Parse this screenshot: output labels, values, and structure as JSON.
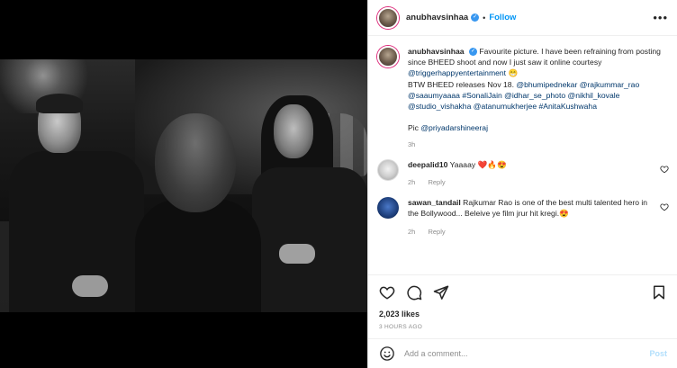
{
  "post": {
    "username": "anubhavsinhaa",
    "verified_glyph": "✓",
    "dot": "•",
    "follow_label": "Follow",
    "more_glyph": "•••",
    "caption": {
      "username": "anubhavsinhaa",
      "text_1": "Favourite picture. I have been refraining from posting since BHEED shoot and now I just saw it online courtesy ",
      "mention_1": "@triggerhappyentertainment",
      "emoji_1": "😁",
      "text_2": "BTW BHEED releases Nov 18. ",
      "mentions_2": "@bhumipednekar @rajkummar_rao @saaumyaaaa #SonaliJain @idhar_se_photo @nikhil_kovale @studio_vishakha @atanumukherjee #AnitaKushwaha",
      "pic_text": "Pic ",
      "pic_mention": "@priyadarshineeraj",
      "time": "3h"
    },
    "comments": [
      {
        "username": "deepalid10",
        "text": "Yaaaay ❤️🔥😍",
        "time": "2h",
        "reply": "Reply"
      },
      {
        "username": "sawan_tandail",
        "text": "Rajkumar Rao is one of the best multi talented hero in the Bollywood... Beleive ye film jrur hit kregi.😍",
        "time": "2h",
        "reply": "Reply"
      }
    ],
    "likes": "2,023 likes",
    "ago": "3 HOURS AGO",
    "add_comment": {
      "placeholder": "Add a comment...",
      "post_label": "Post"
    }
  },
  "icons": {
    "like": "heart-icon",
    "comment": "comment-icon",
    "share": "share-icon",
    "save": "bookmark-icon",
    "emoji": "emoji-icon",
    "comment_like": "heart-icon"
  },
  "colors": {
    "link": "#00376b",
    "follow": "#0095f6",
    "verified": "#3897f0",
    "muted": "#8e8e8e"
  }
}
